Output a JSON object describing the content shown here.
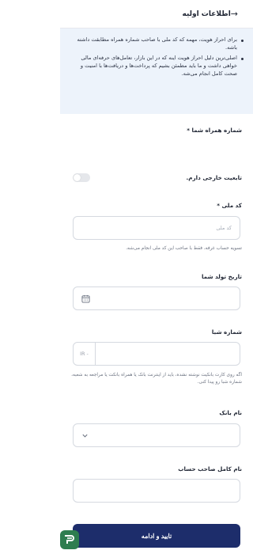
{
  "header": {
    "title": "اطلاعات اولیه",
    "back_icon": "arrow-right-icon"
  },
  "notice": {
    "items": [
      "برای احراز هویت، مهمه که کد ملی با صاحب شماره همراه مطابقت داشته باشه.",
      "اصلی‌ترین دلیل احراز هویت اینه که در این بازار، تعامل‌های حرفه‌ای مالی خواهی داشت و ما باید مطمئن بشیم که پرداخت‌ها و دریافت‌ها با امنیت و صحت کامل انجام می‌شه."
    ]
  },
  "form": {
    "phone_label": "شماره همراه شما *",
    "foreign_label": "تابعیت خارجی دارم.",
    "foreign_enabled": false,
    "national_code_label": "کد ملی *",
    "national_code_placeholder": "کد ملی",
    "national_code_hint": "تسویه حساب غرفه، فقط با صاحب این کد ملی انجام می‌شه.",
    "birth_label": "تاریخ تولد شما",
    "iban_label": "شماره شبا",
    "iban_prefix": "IR -",
    "iban_hint": "اگه روی کارت بانکیت نوشته نشده، باید از اینترنت بانک یا همراه بانکت یا مراجعه به شعبه، شماره شبا رو پیدا کنی.",
    "bank_label": "نام بانک",
    "account_owner_label": "نام کامل صاحب حساب"
  },
  "submit_label": "تایید و ادامه",
  "colors": {
    "primary": "#1d2d6b",
    "notice_bg": "#edf3fb",
    "fab_green": "#2e7d4f"
  }
}
